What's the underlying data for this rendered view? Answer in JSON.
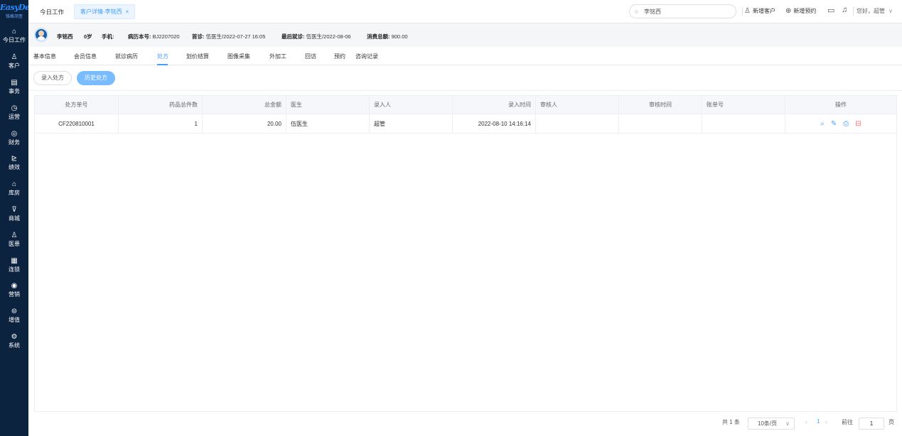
{
  "app": {
    "logo_text": "EasyDent",
    "logo_sub": "铭格牙医"
  },
  "sidebar": {
    "items": [
      {
        "label": "今日工作",
        "icon": "⌂"
      },
      {
        "label": "客户",
        "icon": "♙"
      },
      {
        "label": "事务",
        "icon": "▤"
      },
      {
        "label": "运营",
        "icon": "◷"
      },
      {
        "label": "财务",
        "icon": "◎"
      },
      {
        "label": "绩效",
        "icon": "⊵"
      },
      {
        "label": "库房",
        "icon": "⌂"
      },
      {
        "label": "商城",
        "icon": "⊽"
      },
      {
        "label": "医患",
        "icon": "♙"
      },
      {
        "label": "连锁",
        "icon": "▦"
      },
      {
        "label": "营销",
        "icon": "◉"
      },
      {
        "label": "增值",
        "icon": "⊜"
      },
      {
        "label": "系统",
        "icon": "⚙"
      }
    ]
  },
  "topbar": {
    "home_tab": "今日工作",
    "active_tab": "客户详情-李铭西",
    "close_glyph": "×",
    "search_value": "李铭西",
    "new_customer": "新增客户",
    "new_appointment": "新增预约",
    "greeting": "您好，超管"
  },
  "patient": {
    "name": "李铭西",
    "age": "0岁",
    "phone_label": "手机:",
    "phone_value": "",
    "record_label": "病历本号:",
    "record_value": "BJ2207020",
    "first_visit_label": "首诊:",
    "first_visit_value": "伍医生/2022-07-27 16:05",
    "last_visit_label": "最后就诊:",
    "last_visit_value": "伍医生/2022-08-06",
    "total_label": "消费总额:",
    "total_value": "900.00"
  },
  "subtabs": [
    "基本信息",
    "会员信息",
    "就诊病历",
    "处方",
    "划价结算",
    "图像采集",
    "外加工",
    "回访",
    "预约",
    "咨询记录"
  ],
  "actions": {
    "enter_rx": "录入处方",
    "history_rx": "历史处方"
  },
  "table": {
    "headers": [
      "处方单号",
      "药品总件数",
      "总金额",
      "医生",
      "录入人",
      "录入时间",
      "审核人",
      "审核时间",
      "账单号",
      "操作"
    ],
    "rows": [
      [
        "CF220810001",
        "1",
        "20.00",
        "伍医生",
        "超管",
        "2022-08-10 14:16:14",
        "",
        "",
        ""
      ]
    ]
  },
  "pagination": {
    "total": "共 1 条",
    "page_size": "10条/页",
    "current": "1",
    "goto_label": "前往",
    "goto_value": "1",
    "page_suffix": "页"
  },
  "colors": {
    "sidebar_bg": "#0c2340",
    "primary": "#409eff",
    "primary_light": "#79bbff",
    "danger": "#f56c6c"
  }
}
